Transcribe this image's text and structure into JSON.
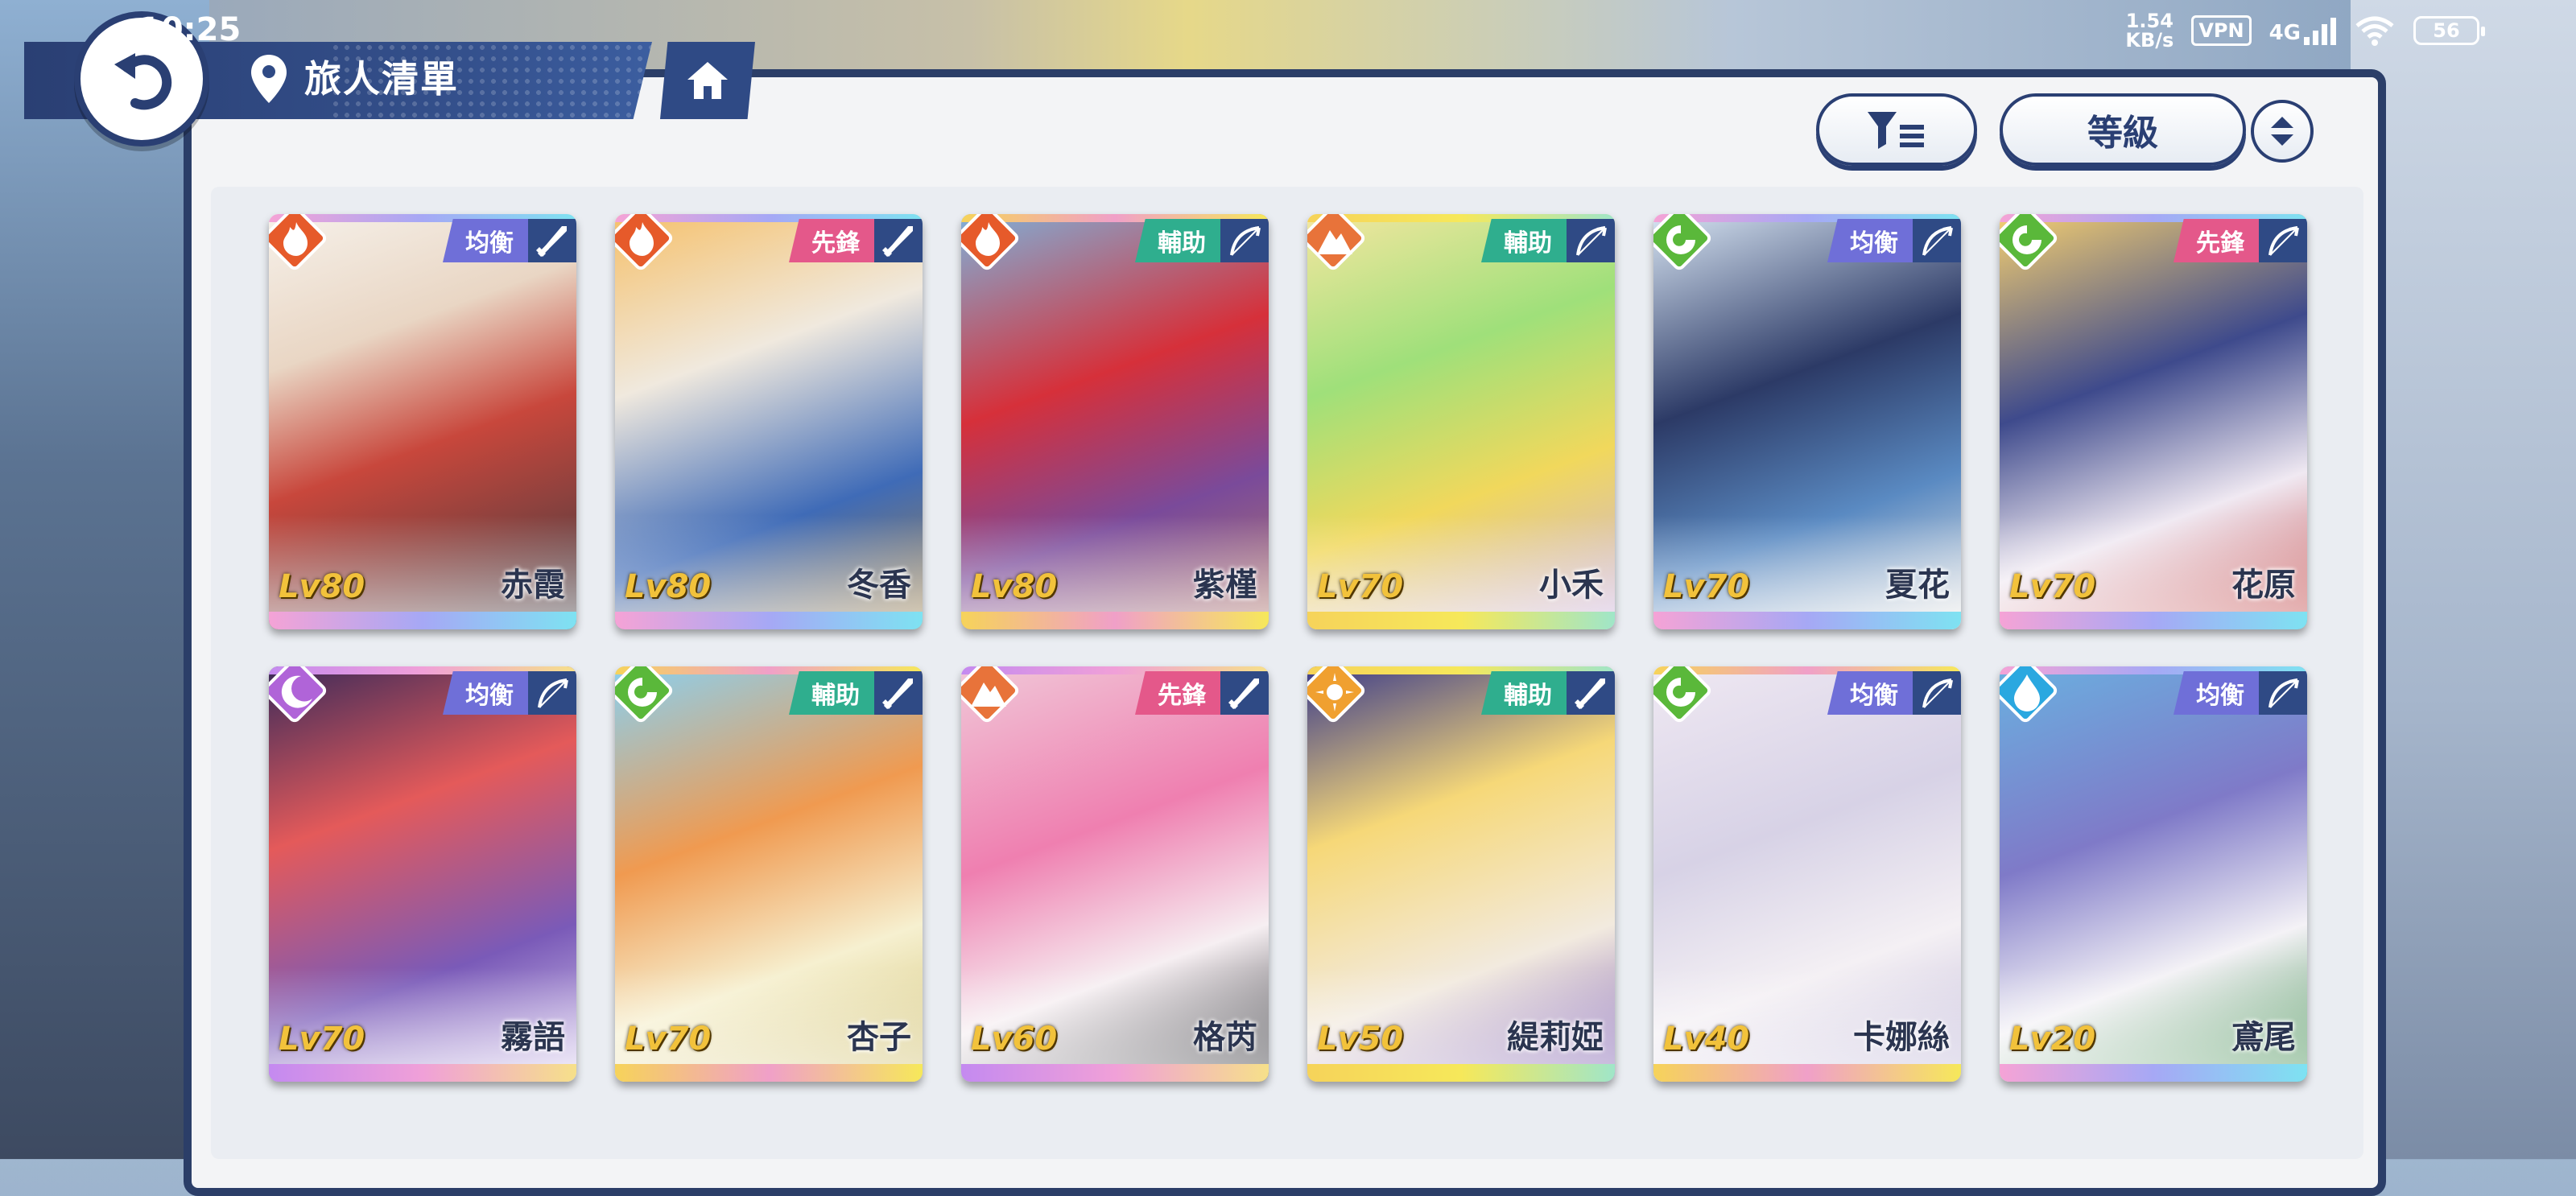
{
  "status_bar": {
    "time": "10:25",
    "speed_value": "1.54",
    "speed_unit": "KB/s",
    "vpn": "VPN",
    "network": "4G",
    "battery": "56"
  },
  "header": {
    "title": "旅人清單"
  },
  "controls": {
    "sort_label": "等級"
  },
  "colors": {
    "navy": "#2a3f73",
    "role_balance": "#6f6fd8",
    "role_vanguard": "#e4588a",
    "role_support": "#2fae8e"
  },
  "characters": [
    {
      "name": "赤霞",
      "level": "Lv80",
      "role": "均衡",
      "element": "fire-icon",
      "weapon": "sword-icon"
    },
    {
      "name": "冬香",
      "level": "Lv80",
      "role": "先鋒",
      "element": "fire-icon",
      "weapon": "sword-icon"
    },
    {
      "name": "紫槿",
      "level": "Lv80",
      "role": "輔助",
      "element": "fire-icon",
      "weapon": "bow-icon"
    },
    {
      "name": "小禾",
      "level": "Lv70",
      "role": "輔助",
      "element": "earth-icon",
      "weapon": "bow-icon"
    },
    {
      "name": "夏花",
      "level": "Lv70",
      "role": "均衡",
      "element": "wind-icon",
      "weapon": "bow-icon"
    },
    {
      "name": "花原",
      "level": "Lv70",
      "role": "先鋒",
      "element": "wind-icon",
      "weapon": "bow-icon"
    },
    {
      "name": "霧語",
      "level": "Lv70",
      "role": "均衡",
      "element": "moon-icon",
      "weapon": "bow-icon"
    },
    {
      "name": "杏子",
      "level": "Lv70",
      "role": "輔助",
      "element": "wind-icon",
      "weapon": "sword-icon"
    },
    {
      "name": "格芮",
      "level": "Lv60",
      "role": "先鋒",
      "element": "earth-icon",
      "weapon": "sword-icon"
    },
    {
      "name": "緹莉婭",
      "level": "Lv50",
      "role": "輔助",
      "element": "sun-icon",
      "weapon": "sword-icon"
    },
    {
      "name": "卡娜絲",
      "level": "Lv40",
      "role": "均衡",
      "element": "wind-icon",
      "weapon": "bow-icon"
    },
    {
      "name": "鳶尾",
      "level": "Lv20",
      "role": "均衡",
      "element": "water-icon",
      "weapon": "bow-icon"
    }
  ]
}
